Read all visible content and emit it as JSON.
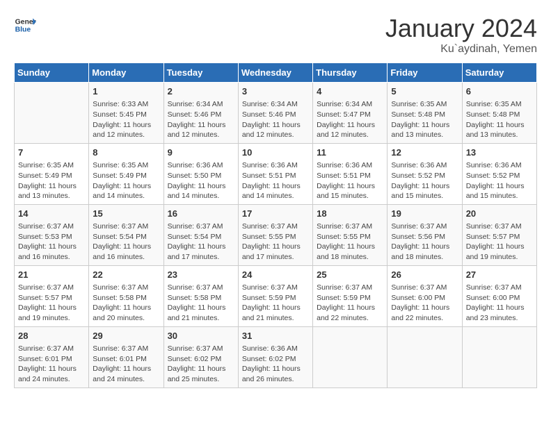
{
  "header": {
    "logo_general": "General",
    "logo_blue": "Blue",
    "title": "January 2024",
    "location": "Ku`aydinah, Yemen"
  },
  "days_of_week": [
    "Sunday",
    "Monday",
    "Tuesday",
    "Wednesday",
    "Thursday",
    "Friday",
    "Saturday"
  ],
  "weeks": [
    [
      {
        "day": "",
        "details": ""
      },
      {
        "day": "1",
        "details": "Sunrise: 6:33 AM\nSunset: 5:45 PM\nDaylight: 11 hours\nand 12 minutes."
      },
      {
        "day": "2",
        "details": "Sunrise: 6:34 AM\nSunset: 5:46 PM\nDaylight: 11 hours\nand 12 minutes."
      },
      {
        "day": "3",
        "details": "Sunrise: 6:34 AM\nSunset: 5:46 PM\nDaylight: 11 hours\nand 12 minutes."
      },
      {
        "day": "4",
        "details": "Sunrise: 6:34 AM\nSunset: 5:47 PM\nDaylight: 11 hours\nand 12 minutes."
      },
      {
        "day": "5",
        "details": "Sunrise: 6:35 AM\nSunset: 5:48 PM\nDaylight: 11 hours\nand 13 minutes."
      },
      {
        "day": "6",
        "details": "Sunrise: 6:35 AM\nSunset: 5:48 PM\nDaylight: 11 hours\nand 13 minutes."
      }
    ],
    [
      {
        "day": "7",
        "details": "Sunrise: 6:35 AM\nSunset: 5:49 PM\nDaylight: 11 hours\nand 13 minutes."
      },
      {
        "day": "8",
        "details": "Sunrise: 6:35 AM\nSunset: 5:49 PM\nDaylight: 11 hours\nand 14 minutes."
      },
      {
        "day": "9",
        "details": "Sunrise: 6:36 AM\nSunset: 5:50 PM\nDaylight: 11 hours\nand 14 minutes."
      },
      {
        "day": "10",
        "details": "Sunrise: 6:36 AM\nSunset: 5:51 PM\nDaylight: 11 hours\nand 14 minutes."
      },
      {
        "day": "11",
        "details": "Sunrise: 6:36 AM\nSunset: 5:51 PM\nDaylight: 11 hours\nand 15 minutes."
      },
      {
        "day": "12",
        "details": "Sunrise: 6:36 AM\nSunset: 5:52 PM\nDaylight: 11 hours\nand 15 minutes."
      },
      {
        "day": "13",
        "details": "Sunrise: 6:36 AM\nSunset: 5:52 PM\nDaylight: 11 hours\nand 15 minutes."
      }
    ],
    [
      {
        "day": "14",
        "details": "Sunrise: 6:37 AM\nSunset: 5:53 PM\nDaylight: 11 hours\nand 16 minutes."
      },
      {
        "day": "15",
        "details": "Sunrise: 6:37 AM\nSunset: 5:54 PM\nDaylight: 11 hours\nand 16 minutes."
      },
      {
        "day": "16",
        "details": "Sunrise: 6:37 AM\nSunset: 5:54 PM\nDaylight: 11 hours\nand 17 minutes."
      },
      {
        "day": "17",
        "details": "Sunrise: 6:37 AM\nSunset: 5:55 PM\nDaylight: 11 hours\nand 17 minutes."
      },
      {
        "day": "18",
        "details": "Sunrise: 6:37 AM\nSunset: 5:55 PM\nDaylight: 11 hours\nand 18 minutes."
      },
      {
        "day": "19",
        "details": "Sunrise: 6:37 AM\nSunset: 5:56 PM\nDaylight: 11 hours\nand 18 minutes."
      },
      {
        "day": "20",
        "details": "Sunrise: 6:37 AM\nSunset: 5:57 PM\nDaylight: 11 hours\nand 19 minutes."
      }
    ],
    [
      {
        "day": "21",
        "details": "Sunrise: 6:37 AM\nSunset: 5:57 PM\nDaylight: 11 hours\nand 19 minutes."
      },
      {
        "day": "22",
        "details": "Sunrise: 6:37 AM\nSunset: 5:58 PM\nDaylight: 11 hours\nand 20 minutes."
      },
      {
        "day": "23",
        "details": "Sunrise: 6:37 AM\nSunset: 5:58 PM\nDaylight: 11 hours\nand 21 minutes."
      },
      {
        "day": "24",
        "details": "Sunrise: 6:37 AM\nSunset: 5:59 PM\nDaylight: 11 hours\nand 21 minutes."
      },
      {
        "day": "25",
        "details": "Sunrise: 6:37 AM\nSunset: 5:59 PM\nDaylight: 11 hours\nand 22 minutes."
      },
      {
        "day": "26",
        "details": "Sunrise: 6:37 AM\nSunset: 6:00 PM\nDaylight: 11 hours\nand 22 minutes."
      },
      {
        "day": "27",
        "details": "Sunrise: 6:37 AM\nSunset: 6:00 PM\nDaylight: 11 hours\nand 23 minutes."
      }
    ],
    [
      {
        "day": "28",
        "details": "Sunrise: 6:37 AM\nSunset: 6:01 PM\nDaylight: 11 hours\nand 24 minutes."
      },
      {
        "day": "29",
        "details": "Sunrise: 6:37 AM\nSunset: 6:01 PM\nDaylight: 11 hours\nand 24 minutes."
      },
      {
        "day": "30",
        "details": "Sunrise: 6:37 AM\nSunset: 6:02 PM\nDaylight: 11 hours\nand 25 minutes."
      },
      {
        "day": "31",
        "details": "Sunrise: 6:36 AM\nSunset: 6:02 PM\nDaylight: 11 hours\nand 26 minutes."
      },
      {
        "day": "",
        "details": ""
      },
      {
        "day": "",
        "details": ""
      },
      {
        "day": "",
        "details": ""
      }
    ]
  ]
}
